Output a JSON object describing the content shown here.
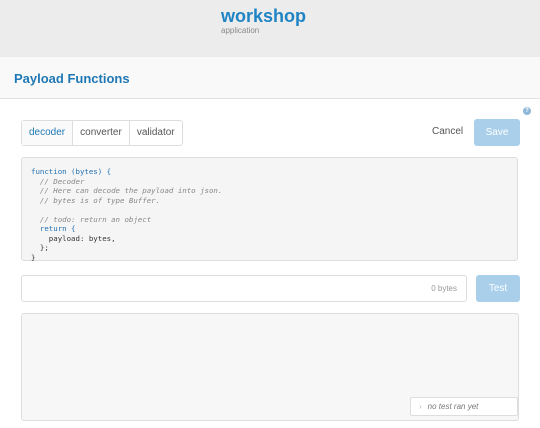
{
  "app": {
    "name": "workshop",
    "subtitle": "application"
  },
  "panel": {
    "title": "Payload Functions",
    "help_icon": "?"
  },
  "tabs": [
    {
      "label": "decoder",
      "active": true
    },
    {
      "label": "converter",
      "active": false
    },
    {
      "label": "validator",
      "active": false
    }
  ],
  "actions": {
    "cancel_label": "Cancel",
    "save_label": "Save"
  },
  "code": {
    "lines": [
      "function (bytes) {",
      "  // Decoder",
      "  // Here can decode the payload into json.",
      "  // bytes is of type Buffer.",
      "",
      "  // todo: return an object",
      "  return {",
      "    payload: bytes,",
      "  };",
      "}"
    ]
  },
  "test": {
    "byte_count": "0 bytes",
    "test_label": "Test",
    "status_text": "no test ran yet",
    "status_icon": "chevron-right-icon"
  },
  "colors": {
    "accent": "#1f78b4",
    "button_disabled": "#a9cfea"
  }
}
